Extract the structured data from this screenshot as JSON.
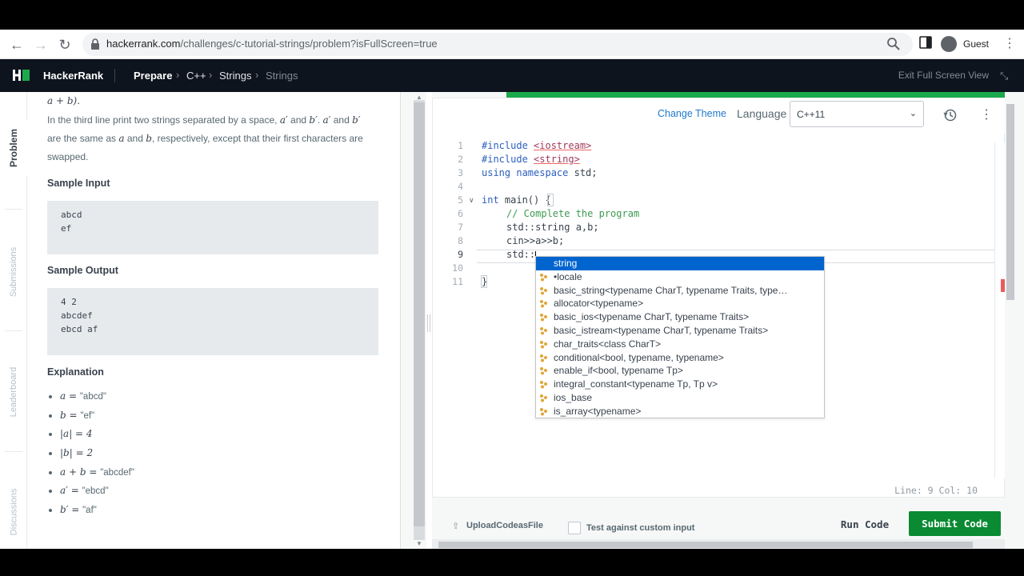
{
  "browser": {
    "url_host": "hackerrank.com",
    "url_path": "/challenges/c-tutorial-strings/problem?isFullScreen=true",
    "profile_label": "Guest"
  },
  "header": {
    "brand": "HackerRank",
    "breadcrumbs": [
      "Prepare",
      "C++",
      "Strings",
      "Strings"
    ],
    "exit_fullscreen": "Exit Full Screen View"
  },
  "sidebar": {
    "tabs": [
      "Problem",
      "Submissions",
      "Leaderboard",
      "Discussions"
    ]
  },
  "problem": {
    "top_line": "a + b).",
    "para_1": "In the third line print two strings separated by a space, ",
    "para_a1": "a′",
    "para_and1": " and ",
    "para_b1": "b′",
    "para_dot": ". ",
    "para_a2": "a′",
    "para_and2": " and ",
    "para_b2": "b′",
    "para_2": "are the same as ",
    "para_a": "a",
    "para_and3": " and ",
    "para_b": "b",
    "para_3": ", respectively, except that their first characters are",
    "para_4": "swapped.",
    "sample_input_title": "Sample Input",
    "sample_input": [
      "abcd",
      "ef"
    ],
    "sample_output_title": "Sample Output",
    "sample_output": [
      "4 2",
      "abcdef",
      "ebcd af"
    ],
    "explanation_title": "Explanation",
    "explanation": [
      {
        "lhs": "a = ",
        "rhs": "\"abcd\""
      },
      {
        "lhs": "b = ",
        "rhs": "\"ef\""
      },
      {
        "lhs": "|a| = 4",
        "rhs": ""
      },
      {
        "lhs": "|b| = 2",
        "rhs": ""
      },
      {
        "lhs": "a + b = ",
        "rhs": "\"abcdef\""
      },
      {
        "lhs": "a′ = ",
        "rhs": "\"ebcd\""
      },
      {
        "lhs": "b′ = ",
        "rhs": "\"af\""
      }
    ]
  },
  "editor": {
    "change_theme": "Change Theme",
    "language_label": "Language",
    "language_value": "C++11",
    "line_numbers": [
      "1",
      "2",
      "3",
      "4",
      "5",
      "6",
      "7",
      "8",
      "9",
      "10",
      "11"
    ],
    "status": "Line: 9 Col: 10",
    "autocomplete": [
      "string",
      "•locale",
      "basic_string<typename CharT, typename Traits, type…",
      "allocator<typename>",
      "basic_ios<typename CharT, typename Traits>",
      "basic_istream<typename CharT, typename Traits>",
      "char_traits<class CharT>",
      "conditional<bool, typename, typename>",
      "enable_if<bool, typename Tp>",
      "integral_constant<typename Tp, Tp v>",
      "ios_base",
      "is_array<typename>"
    ]
  },
  "code": {
    "l1_kw": "#include ",
    "l1_s": "<iostream>",
    "l2_kw": "#include ",
    "l2_s": "<string>",
    "l3_kw": "using namespace",
    "l3_rest": " std;",
    "l5_kw": "int",
    "l5_rest": " main() {",
    "l6": "// Complete the program",
    "l7": "std::string a,b;",
    "l8": "cin>>a>>b;",
    "l9": "std::",
    "l11": "}"
  },
  "actions": {
    "upload": "UploadCodeasFile",
    "custom_input": "Test against custom input",
    "run": "Run Code",
    "submit": "Submit Code"
  },
  "colors": {
    "header_bg": "#0e141e",
    "accent_green": "#1ba94c",
    "submit_green": "#0a8a33",
    "link_blue": "#1f7acc",
    "selection_blue": "#0064cf"
  }
}
